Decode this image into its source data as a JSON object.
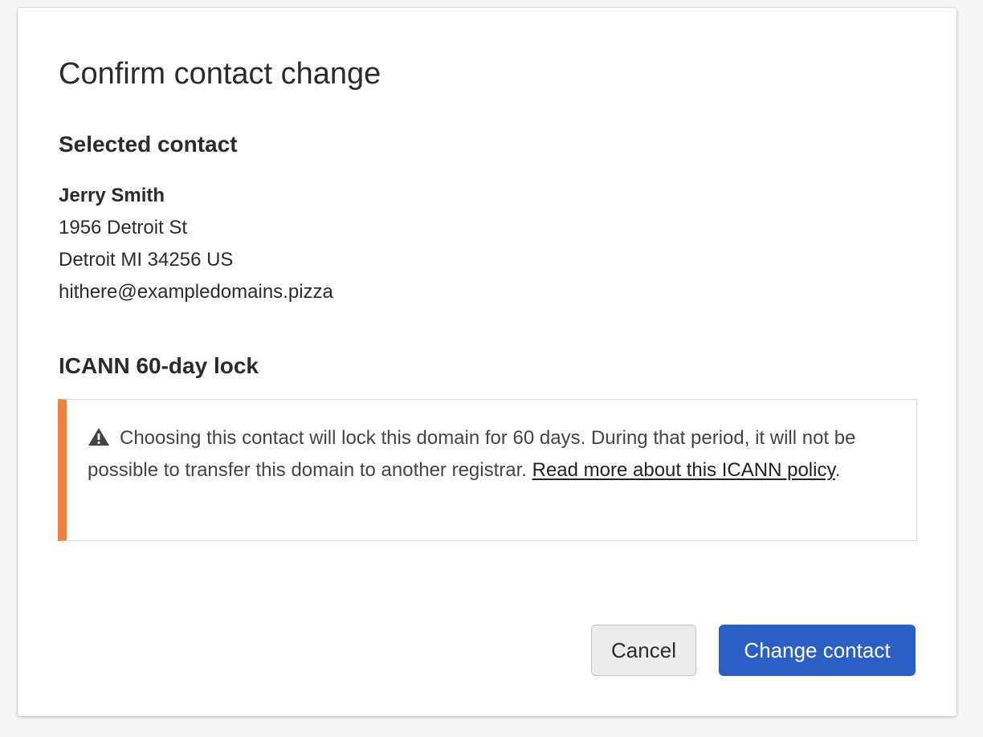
{
  "dialog": {
    "title": "Confirm contact change"
  },
  "selected_contact": {
    "heading": "Selected contact",
    "name": "Jerry Smith",
    "address_line1": "1956 Detroit St",
    "address_line2": "Detroit MI 34256 US",
    "email": "hithere@exampledomains.pizza"
  },
  "lock": {
    "heading": "ICANN 60-day lock",
    "warning_icon": "warning-triangle-icon",
    "message": "Choosing this contact will lock this domain for 60 days. During that period, it will not be possible to transfer this domain to another registrar. ",
    "link_text": "Read more about this ICANN policy",
    "trailing": ".",
    "accent_color": "#f0823c"
  },
  "actions": {
    "cancel_label": "Cancel",
    "confirm_label": "Change contact",
    "primary_color": "#2c5fc4"
  }
}
